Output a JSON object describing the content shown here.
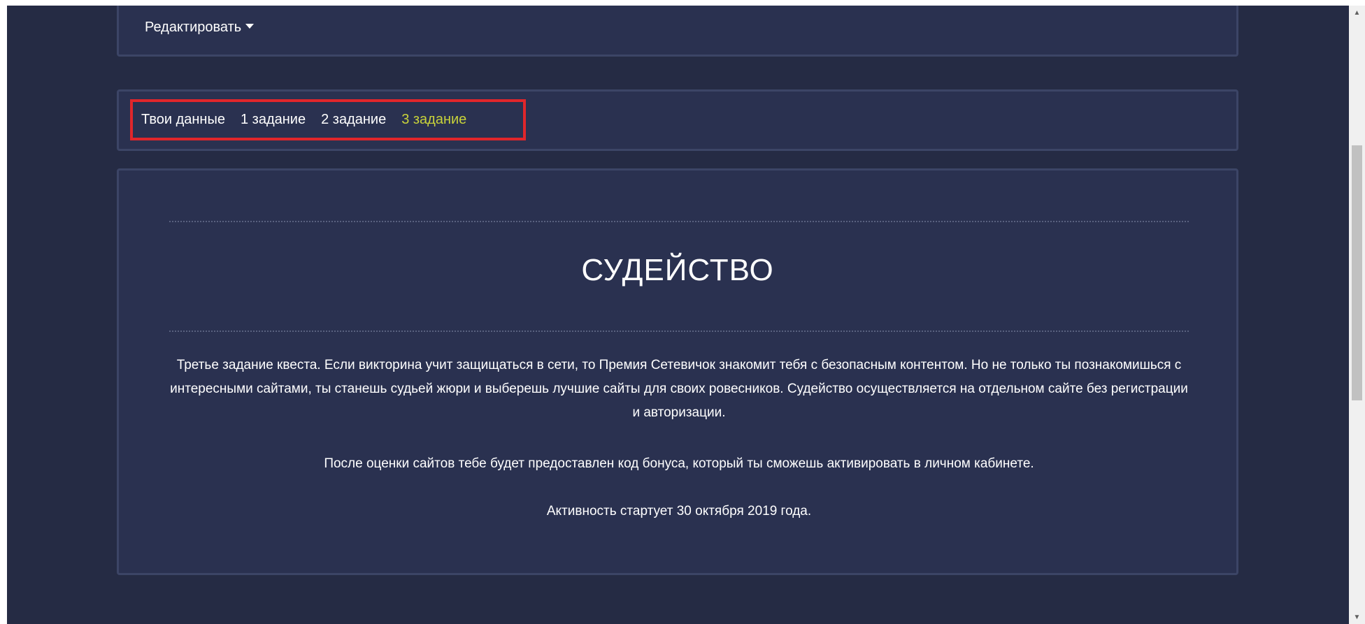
{
  "header": {
    "dropdown_label": "Редактировать"
  },
  "nav": {
    "tabs": [
      {
        "label": "Твои данные",
        "active": false
      },
      {
        "label": "1 задание",
        "active": false
      },
      {
        "label": "2 задание",
        "active": false
      },
      {
        "label": "3 задание",
        "active": true
      }
    ],
    "active_color": "#c8d23a",
    "highlight_color": "#e0262b"
  },
  "content": {
    "title": "СУДЕЙСТВО",
    "paragraphs": [
      "Третье задание квеста. Если викторина учит защищаться в сети, то Премия Сетевичок знакомит тебя с безопасным контентом. Но не только ты познакомишься с интересными сайтами, ты станешь судьей жюри и выберешь лучшие сайты для своих ровесников. Судейство осуществляется на отдельном сайте без регистрации и авторизации.",
      "После оценки сайтов тебе будет предоставлен код бонуса, который ты сможешь активировать в личном кабинете.",
      "Активность стартует 30 октября 2019 года."
    ]
  },
  "colors": {
    "background": "#252b44",
    "panel": "#2a3150",
    "panel_border": "#3c4566"
  },
  "scrollbar": {
    "up_icon": "▲",
    "down_icon": "▼"
  }
}
